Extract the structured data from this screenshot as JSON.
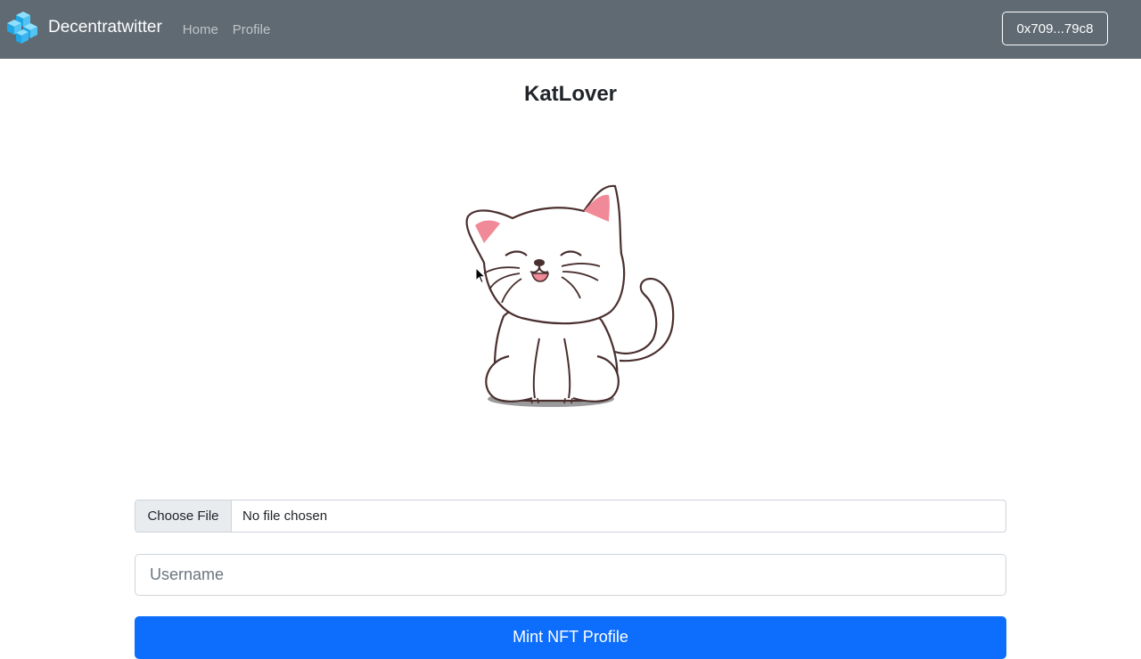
{
  "navbar": {
    "brand": "Decentratwitter",
    "links": [
      {
        "label": "Home"
      },
      {
        "label": "Profile"
      }
    ],
    "wallet_address": "0x709...79c8",
    "background": "#5f6a72",
    "logo_icon": "cube-logo-icon"
  },
  "profile": {
    "username": "KatLover",
    "avatar_icon": "cat-avatar-image"
  },
  "form": {
    "file_button": "Choose File",
    "file_status": "No file chosen",
    "username_placeholder": "Username",
    "username_value": "",
    "submit_label": "Mint NFT Profile",
    "submit_color": "#0d6efd"
  }
}
